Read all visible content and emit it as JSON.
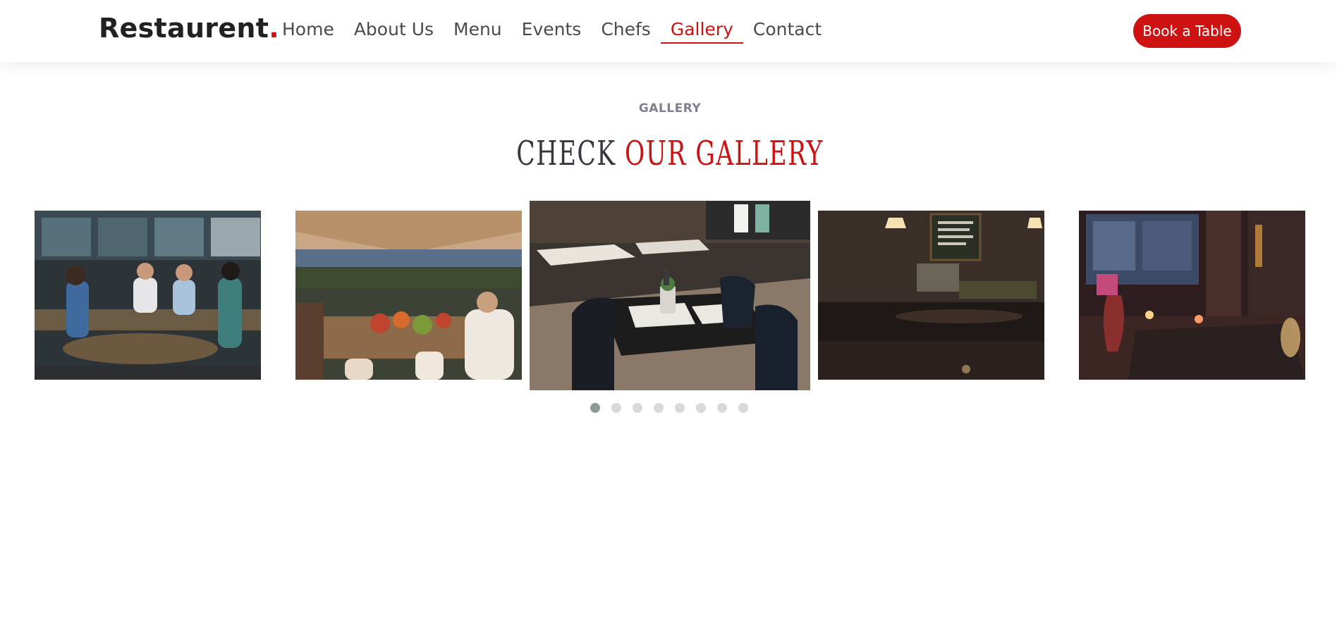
{
  "header": {
    "logo_text": "Restaurent",
    "logo_dot": ".",
    "nav": [
      "Home",
      "About Us",
      "Menu",
      "Events",
      "Chefs",
      "Gallery",
      "Contact"
    ],
    "active_nav": "Gallery",
    "cta_label": "Book a Table"
  },
  "gallery": {
    "subtitle": "GALLERY",
    "title_plain": "CHECK",
    "title_accent": "OUR GALLERY",
    "slide_count": 8,
    "active_slide": 1
  },
  "colors": {
    "accent": "#ce1212",
    "text": "#37373f",
    "muted": "#7f7f90"
  }
}
